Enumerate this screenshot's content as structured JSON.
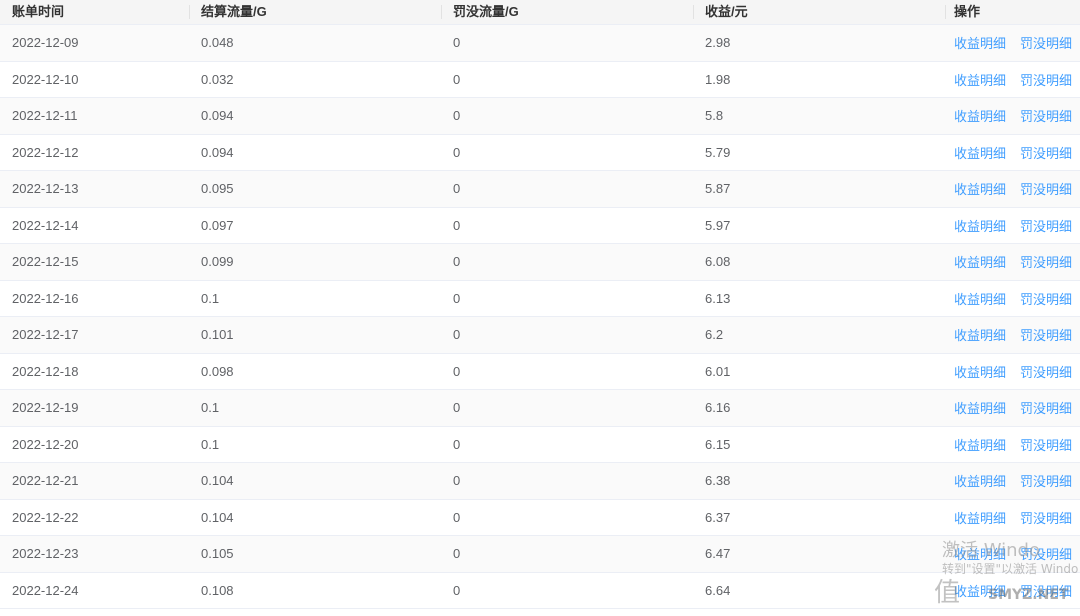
{
  "table": {
    "columns": [
      "账单时间",
      "结算流量/G",
      "罚没流量/G",
      "收益/元",
      "操作"
    ],
    "action_labels": {
      "income_detail": "收益明细",
      "penalty_detail": "罚没明细"
    },
    "rows": [
      {
        "date": "2022-12-09",
        "settled": "0.048",
        "penalty": "0",
        "income": "2.98"
      },
      {
        "date": "2022-12-10",
        "settled": "0.032",
        "penalty": "0",
        "income": "1.98"
      },
      {
        "date": "2022-12-11",
        "settled": "0.094",
        "penalty": "0",
        "income": "5.8"
      },
      {
        "date": "2022-12-12",
        "settled": "0.094",
        "penalty": "0",
        "income": "5.79"
      },
      {
        "date": "2022-12-13",
        "settled": "0.095",
        "penalty": "0",
        "income": "5.87"
      },
      {
        "date": "2022-12-14",
        "settled": "0.097",
        "penalty": "0",
        "income": "5.97"
      },
      {
        "date": "2022-12-15",
        "settled": "0.099",
        "penalty": "0",
        "income": "6.08"
      },
      {
        "date": "2022-12-16",
        "settled": "0.1",
        "penalty": "0",
        "income": "6.13"
      },
      {
        "date": "2022-12-17",
        "settled": "0.101",
        "penalty": "0",
        "income": "6.2"
      },
      {
        "date": "2022-12-18",
        "settled": "0.098",
        "penalty": "0",
        "income": "6.01"
      },
      {
        "date": "2022-12-19",
        "settled": "0.1",
        "penalty": "0",
        "income": "6.16"
      },
      {
        "date": "2022-12-20",
        "settled": "0.1",
        "penalty": "0",
        "income": "6.15"
      },
      {
        "date": "2022-12-21",
        "settled": "0.104",
        "penalty": "0",
        "income": "6.38"
      },
      {
        "date": "2022-12-22",
        "settled": "0.104",
        "penalty": "0",
        "income": "6.37"
      },
      {
        "date": "2022-12-23",
        "settled": "0.105",
        "penalty": "0",
        "income": "6.47"
      },
      {
        "date": "2022-12-24",
        "settled": "0.108",
        "penalty": "0",
        "income": "6.64"
      }
    ]
  },
  "watermark": {
    "activate_line1": "激活 Windo",
    "activate_line2": "转到\"设置\"以激活 Windo",
    "site_glyph": "值",
    "site_text": "SMYZ.NET"
  },
  "colors": {
    "link": "#409eff",
    "header_bg": "#f5f5f5",
    "stripe_bg": "#fafafa",
    "border": "#ebeef5"
  }
}
